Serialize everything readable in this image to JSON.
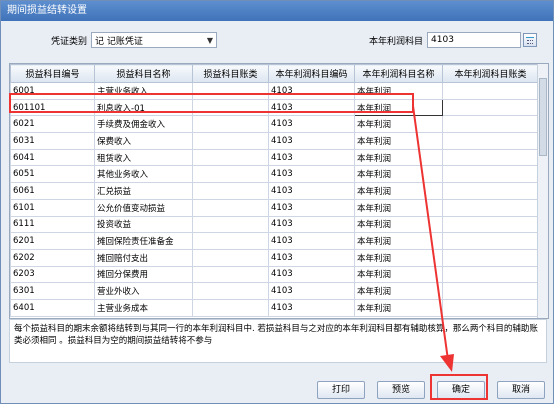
{
  "window": {
    "title": "期间损益结转设置"
  },
  "form": {
    "voucher_type_label": "凭证类别",
    "voucher_type_value": "记  记账凭证",
    "profit_account_label": "本年利润科目",
    "profit_account_value": "4103"
  },
  "table": {
    "headers": [
      "损益科目编号",
      "损益科目名称",
      "损益科目账类",
      "本年利润科目编码",
      "本年利润科目名称",
      "本年利润科目账类"
    ],
    "rows": [
      [
        "6001",
        "主营业务收入",
        "",
        "4103",
        "本年利润",
        ""
      ],
      [
        "601101",
        "利息收入-01",
        "",
        "4103",
        "本年利润",
        ""
      ],
      [
        "6021",
        "手续费及佣金收入",
        "",
        "4103",
        "本年利润",
        ""
      ],
      [
        "6031",
        "保费收入",
        "",
        "4103",
        "本年利润",
        ""
      ],
      [
        "6041",
        "租赁收入",
        "",
        "4103",
        "本年利润",
        ""
      ],
      [
        "6051",
        "其他业务收入",
        "",
        "4103",
        "本年利润",
        ""
      ],
      [
        "6061",
        "汇兑损益",
        "",
        "4103",
        "本年利润",
        ""
      ],
      [
        "6101",
        "公允价值变动损益",
        "",
        "4103",
        "本年利润",
        ""
      ],
      [
        "6111",
        "投资收益",
        "",
        "4103",
        "本年利润",
        ""
      ],
      [
        "6201",
        "摊回保险责任准备金",
        "",
        "4103",
        "本年利润",
        ""
      ],
      [
        "6202",
        "摊回赔付支出",
        "",
        "4103",
        "本年利润",
        ""
      ],
      [
        "6203",
        "摊回分保费用",
        "",
        "4103",
        "本年利润",
        ""
      ],
      [
        "6301",
        "营业外收入",
        "",
        "4103",
        "本年利润",
        ""
      ],
      [
        "6401",
        "主营业务成本",
        "",
        "4103",
        "本年利润",
        ""
      ]
    ]
  },
  "note": "每个损益科目的期末余额将结转到与其同一行的本年利润科目中. 若损益科目与之对应的本年利润科目都有辅助核算，那么两个科目的辅助账类必须相同  。损益科目为空的期间损益结转将不参与",
  "buttons": {
    "print": "打印",
    "preview": "预览",
    "ok": "确定",
    "cancel": "取消"
  },
  "colors": {
    "annotation": "#e33",
    "title_bar": "#4a7fc4"
  }
}
